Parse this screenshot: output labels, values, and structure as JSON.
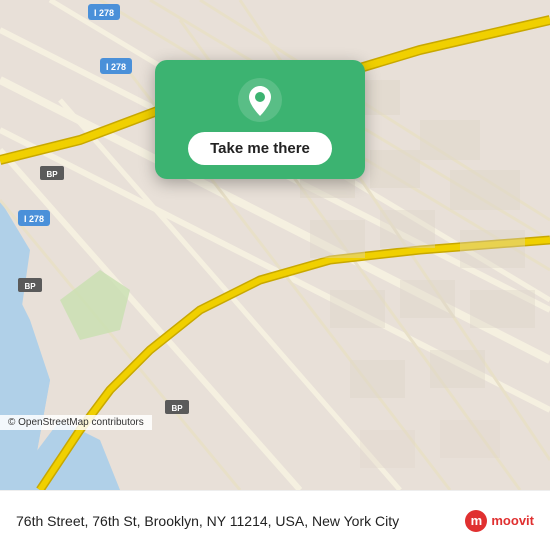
{
  "map": {
    "attribution": "© OpenStreetMap contributors",
    "background_color": "#e8e0d8"
  },
  "popup": {
    "button_label": "Take me there",
    "pin_icon": "location-pin-icon"
  },
  "bottom_bar": {
    "address": "76th Street, 76th St, Brooklyn, NY 11214, USA, New York City",
    "logo_text": "moovit",
    "logo_letter": "m"
  }
}
